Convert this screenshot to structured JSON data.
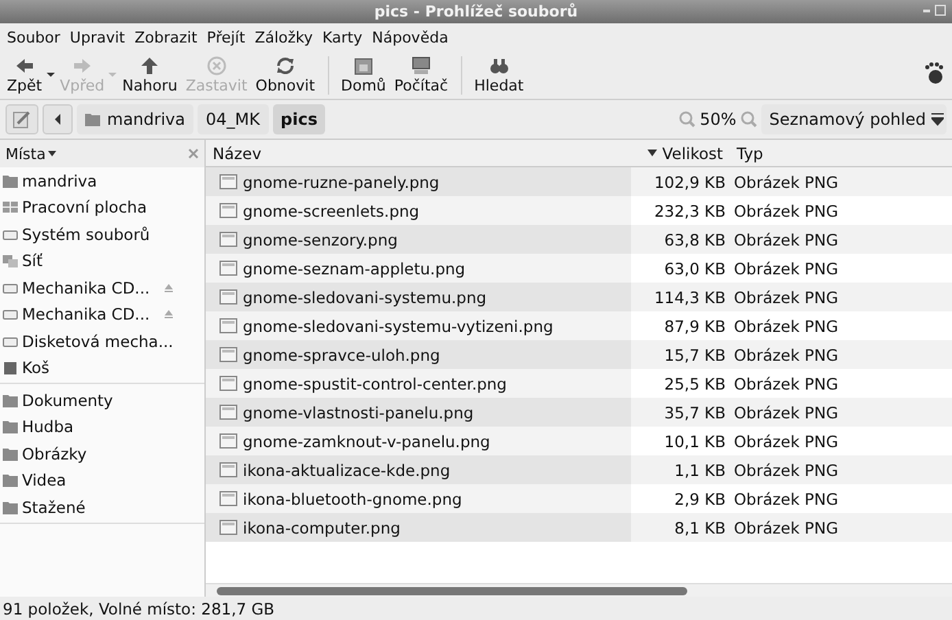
{
  "window": {
    "title": "pics - Prohlížeč souborů"
  },
  "menu": [
    "Soubor",
    "Upravit",
    "Zobrazit",
    "Přejít",
    "Záložky",
    "Karty",
    "Nápověda"
  ],
  "toolbar": [
    {
      "kind": "back",
      "label": "Zpět",
      "disabled": false,
      "dropdown": true
    },
    {
      "kind": "forward",
      "label": "Vpřed",
      "disabled": true,
      "dropdown": true
    },
    {
      "kind": "up",
      "label": "Nahoru",
      "disabled": false,
      "dropdown": false
    },
    {
      "kind": "stop",
      "label": "Zastavit",
      "disabled": true,
      "dropdown": false
    },
    {
      "kind": "reload",
      "label": "Obnovit",
      "disabled": false,
      "dropdown": false
    },
    {
      "kind": "home",
      "label": "Domů",
      "disabled": false,
      "dropdown": false
    },
    {
      "kind": "computer",
      "label": "Počítač",
      "disabled": false,
      "dropdown": false
    },
    {
      "kind": "search",
      "label": "Hledat",
      "disabled": false,
      "dropdown": false
    }
  ],
  "path": [
    {
      "label": "mandriva",
      "selected": false,
      "folder": true
    },
    {
      "label": "04_MK",
      "selected": false,
      "folder": false
    },
    {
      "label": "pics",
      "selected": true,
      "folder": false
    }
  ],
  "zoom": "50%",
  "view": "Seznamový pohled",
  "sidebar": {
    "title": "Místa",
    "groups": [
      [
        {
          "label": "mandriva",
          "kind": "folder",
          "eject": false
        },
        {
          "label": "Pracovní plocha",
          "kind": "desktop",
          "eject": false
        },
        {
          "label": "Systém souborů",
          "kind": "drive",
          "eject": false
        },
        {
          "label": "Síť",
          "kind": "network",
          "eject": false
        },
        {
          "label": "Mechanika CD...",
          "kind": "drive",
          "eject": true
        },
        {
          "label": "Mechanika CD...",
          "kind": "drive",
          "eject": true
        },
        {
          "label": "Disketová mecha...",
          "kind": "drive",
          "eject": false
        },
        {
          "label": "Koš",
          "kind": "trash",
          "eject": false
        }
      ],
      [
        {
          "label": "Dokumenty",
          "kind": "folder",
          "eject": false
        },
        {
          "label": "Hudba",
          "kind": "folder",
          "eject": false
        },
        {
          "label": "Obrázky",
          "kind": "folder",
          "eject": false
        },
        {
          "label": "Videa",
          "kind": "folder",
          "eject": false
        },
        {
          "label": "Stažené",
          "kind": "folder",
          "eject": false
        }
      ]
    ]
  },
  "table": {
    "columns": [
      "Název",
      "Velikost",
      "Typ"
    ],
    "rows": [
      {
        "name": "gnome-ruzne-panely.png",
        "size": "102,9 KB",
        "type": "Obrázek PNG"
      },
      {
        "name": "gnome-screenlets.png",
        "size": "232,3 KB",
        "type": "Obrázek PNG"
      },
      {
        "name": "gnome-senzory.png",
        "size": "63,8 KB",
        "type": "Obrázek PNG"
      },
      {
        "name": "gnome-seznam-appletu.png",
        "size": "63,0 KB",
        "type": "Obrázek PNG"
      },
      {
        "name": "gnome-sledovani-systemu.png",
        "size": "114,3 KB",
        "type": "Obrázek PNG"
      },
      {
        "name": "gnome-sledovani-systemu-vytizeni.png",
        "size": "87,9 KB",
        "type": "Obrázek PNG"
      },
      {
        "name": "gnome-spravce-uloh.png",
        "size": "15,7 KB",
        "type": "Obrázek PNG"
      },
      {
        "name": "gnome-spustit-control-center.png",
        "size": "25,5 KB",
        "type": "Obrázek PNG"
      },
      {
        "name": "gnome-vlastnosti-panelu.png",
        "size": "35,7 KB",
        "type": "Obrázek PNG"
      },
      {
        "name": "gnome-zamknout-v-panelu.png",
        "size": "10,1 KB",
        "type": "Obrázek PNG"
      },
      {
        "name": "ikona-aktualizace-kde.png",
        "size": "1,1 KB",
        "type": "Obrázek PNG"
      },
      {
        "name": "ikona-bluetooth-gnome.png",
        "size": "2,9 KB",
        "type": "Obrázek PNG"
      },
      {
        "name": "ikona-computer.png",
        "size": "8,1 KB",
        "type": "Obrázek PNG"
      }
    ]
  },
  "status_bar": "91 položek, Volné místo: 281,7 GB"
}
